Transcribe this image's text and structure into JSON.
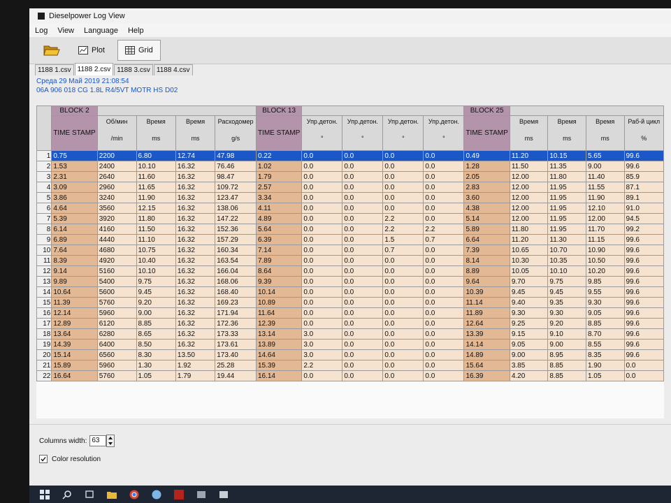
{
  "window": {
    "title": "Dieselpower Log View"
  },
  "menu": [
    "Log",
    "View",
    "Language",
    "Help"
  ],
  "toolbar": {
    "open_icon": "folder-open-icon",
    "plot_label": "Plot",
    "grid_label": "Grid"
  },
  "tabs": [
    {
      "label": "1188 1.csv",
      "active": false
    },
    {
      "label": "1188 2.csv",
      "active": true
    },
    {
      "label": "1188 3.csv",
      "active": false
    },
    {
      "label": "1188 4.csv",
      "active": false
    }
  ],
  "file_info": {
    "date": "Среда 29 Май 2019 21:08:54",
    "ecu": "06A 906 018 CG  1.8L R4/5VT MOTR HS D02"
  },
  "grid": {
    "groups": [
      {
        "label": "BLOCK 2",
        "span": 1,
        "block": true
      },
      {
        "label": "",
        "span": 4,
        "block": false
      },
      {
        "label": "BLOCK 13",
        "span": 1,
        "block": true
      },
      {
        "label": "",
        "span": 4,
        "block": false
      },
      {
        "label": "BLOCK 25",
        "span": 1,
        "block": true
      },
      {
        "label": "",
        "span": 4,
        "block": false
      }
    ],
    "columns": [
      {
        "name": "TIME STAMP",
        "unit": "",
        "ts": true
      },
      {
        "name": "Об/мин",
        "unit": "/min",
        "ts": false
      },
      {
        "name": "Время",
        "unit": "ms",
        "ts": false
      },
      {
        "name": "Время",
        "unit": "ms",
        "ts": false
      },
      {
        "name": "Расходомер",
        "unit": "g/s",
        "ts": false
      },
      {
        "name": "TIME STAMP",
        "unit": "",
        "ts": true
      },
      {
        "name": "Упр.детон.",
        "unit": "°",
        "ts": false
      },
      {
        "name": "Упр.детон.",
        "unit": "°",
        "ts": false
      },
      {
        "name": "Упр.детон.",
        "unit": "°",
        "ts": false
      },
      {
        "name": "Упр.детон.",
        "unit": "°",
        "ts": false
      },
      {
        "name": "TIME STAMP",
        "unit": "",
        "ts": true
      },
      {
        "name": "Время",
        "unit": "ms",
        "ts": false
      },
      {
        "name": "Время",
        "unit": "ms",
        "ts": false
      },
      {
        "name": "Время",
        "unit": "ms",
        "ts": false
      },
      {
        "name": "Раб-й цикл",
        "unit": "%",
        "ts": false
      }
    ],
    "selected_row": 1,
    "rows": [
      [
        "0.75",
        "2200",
        "6.80",
        "12.74",
        "47.98",
        "0.22",
        "0.0",
        "0.0",
        "0.0",
        "0.0",
        "0.49",
        "11.20",
        "10.15",
        "5.65",
        "99.6"
      ],
      [
        "1.53",
        "2400",
        "10.10",
        "16.32",
        "76.46",
        "1.02",
        "0.0",
        "0.0",
        "0.0",
        "0.0",
        "1.28",
        "11.50",
        "11.35",
        "9.00",
        "99.6"
      ],
      [
        "2.31",
        "2640",
        "11.60",
        "16.32",
        "98.47",
        "1.79",
        "0.0",
        "0.0",
        "0.0",
        "0.0",
        "2.05",
        "12.00",
        "11.80",
        "11.40",
        "85.9"
      ],
      [
        "3.09",
        "2960",
        "11.65",
        "16.32",
        "109.72",
        "2.57",
        "0.0",
        "0.0",
        "0.0",
        "0.0",
        "2.83",
        "12.00",
        "11.95",
        "11.55",
        "87.1"
      ],
      [
        "3.86",
        "3240",
        "11.90",
        "16.32",
        "123.47",
        "3.34",
        "0.0",
        "0.0",
        "0.0",
        "0.0",
        "3.60",
        "12.00",
        "11.95",
        "11.90",
        "89.1"
      ],
      [
        "4.64",
        "3560",
        "12.15",
        "16.32",
        "138.06",
        "4.11",
        "0.0",
        "0.0",
        "0.0",
        "0.0",
        "4.38",
        "12.00",
        "11.95",
        "12.10",
        "91.0"
      ],
      [
        "5.39",
        "3920",
        "11.80",
        "16.32",
        "147.22",
        "4.89",
        "0.0",
        "0.0",
        "2.2",
        "0.0",
        "5.14",
        "12.00",
        "11.95",
        "12.00",
        "94.5"
      ],
      [
        "6.14",
        "4160",
        "11.50",
        "16.32",
        "152.36",
        "5.64",
        "0.0",
        "0.0",
        "2.2",
        "2.2",
        "5.89",
        "11.80",
        "11.95",
        "11.70",
        "99.2"
      ],
      [
        "6.89",
        "4440",
        "11.10",
        "16.32",
        "157.29",
        "6.39",
        "0.0",
        "0.0",
        "1.5",
        "0.7",
        "6.64",
        "11.20",
        "11.30",
        "11.15",
        "99.6"
      ],
      [
        "7.64",
        "4680",
        "10.75",
        "16.32",
        "160.34",
        "7.14",
        "0.0",
        "0.0",
        "0.7",
        "0.0",
        "7.39",
        "10.65",
        "10.70",
        "10.90",
        "99.6"
      ],
      [
        "8.39",
        "4920",
        "10.40",
        "16.32",
        "163.54",
        "7.89",
        "0.0",
        "0.0",
        "0.0",
        "0.0",
        "8.14",
        "10.30",
        "10.35",
        "10.50",
        "99.6"
      ],
      [
        "9.14",
        "5160",
        "10.10",
        "16.32",
        "166.04",
        "8.64",
        "0.0",
        "0.0",
        "0.0",
        "0.0",
        "8.89",
        "10.05",
        "10.10",
        "10.20",
        "99.6"
      ],
      [
        "9.89",
        "5400",
        "9.75",
        "16.32",
        "168.06",
        "9.39",
        "0.0",
        "0.0",
        "0.0",
        "0.0",
        "9.64",
        "9.70",
        "9.75",
        "9.85",
        "99.6"
      ],
      [
        "10.64",
        "5600",
        "9.45",
        "16.32",
        "168.40",
        "10.14",
        "0.0",
        "0.0",
        "0.0",
        "0.0",
        "10.39",
        "9.45",
        "9.45",
        "9.55",
        "99.6"
      ],
      [
        "11.39",
        "5760",
        "9.20",
        "16.32",
        "169.23",
        "10.89",
        "0.0",
        "0.0",
        "0.0",
        "0.0",
        "11.14",
        "9.40",
        "9.35",
        "9.30",
        "99.6"
      ],
      [
        "12.14",
        "5960",
        "9.00",
        "16.32",
        "171.94",
        "11.64",
        "0.0",
        "0.0",
        "0.0",
        "0.0",
        "11.89",
        "9.30",
        "9.30",
        "9.05",
        "99.6"
      ],
      [
        "12.89",
        "6120",
        "8.85",
        "16.32",
        "172.36",
        "12.39",
        "0.0",
        "0.0",
        "0.0",
        "0.0",
        "12.64",
        "9.25",
        "9.20",
        "8.85",
        "99.6"
      ],
      [
        "13.64",
        "6280",
        "8.65",
        "16.32",
        "173.33",
        "13.14",
        "3.0",
        "0.0",
        "0.0",
        "0.0",
        "13.39",
        "9.15",
        "9.10",
        "8.70",
        "99.6"
      ],
      [
        "14.39",
        "6400",
        "8.50",
        "16.32",
        "173.61",
        "13.89",
        "3.0",
        "0.0",
        "0.0",
        "0.0",
        "14.14",
        "9.05",
        "9.00",
        "8.55",
        "99.6"
      ],
      [
        "15.14",
        "6560",
        "8.30",
        "13.50",
        "173.40",
        "14.64",
        "3.0",
        "0.0",
        "0.0",
        "0.0",
        "14.89",
        "9.00",
        "8.95",
        "8.35",
        "99.6"
      ],
      [
        "15.89",
        "5960",
        "1.30",
        "1.92",
        "25.28",
        "15.39",
        "2.2",
        "0.0",
        "0.0",
        "0.0",
        "15.64",
        "3.85",
        "8.85",
        "1.90",
        "0.0"
      ],
      [
        "16.64",
        "5760",
        "1.05",
        "1.79",
        "19.44",
        "16.14",
        "0.0",
        "0.0",
        "0.0",
        "0.0",
        "16.39",
        "4.20",
        "8.85",
        "1.05",
        "0.0"
      ]
    ]
  },
  "bottom": {
    "columns_width_label": "Columns width:",
    "columns_width_value": "63",
    "color_resolution_label": "Color resolution",
    "color_resolution_checked": true
  },
  "taskbar": [
    "windows-start-icon",
    "search-icon",
    "task-view-icon",
    "file-explorer-icon",
    "chrome-icon",
    "skype-icon",
    "acrobat-icon",
    "app-icon",
    "dieselpower-app-icon"
  ],
  "colors": {
    "selection": "#1c57c8",
    "block_header": "#b394ab",
    "timestamp_cell": "#e3b894",
    "value_cell": "#f5e2cf",
    "info_text": "#1a56c8"
  }
}
